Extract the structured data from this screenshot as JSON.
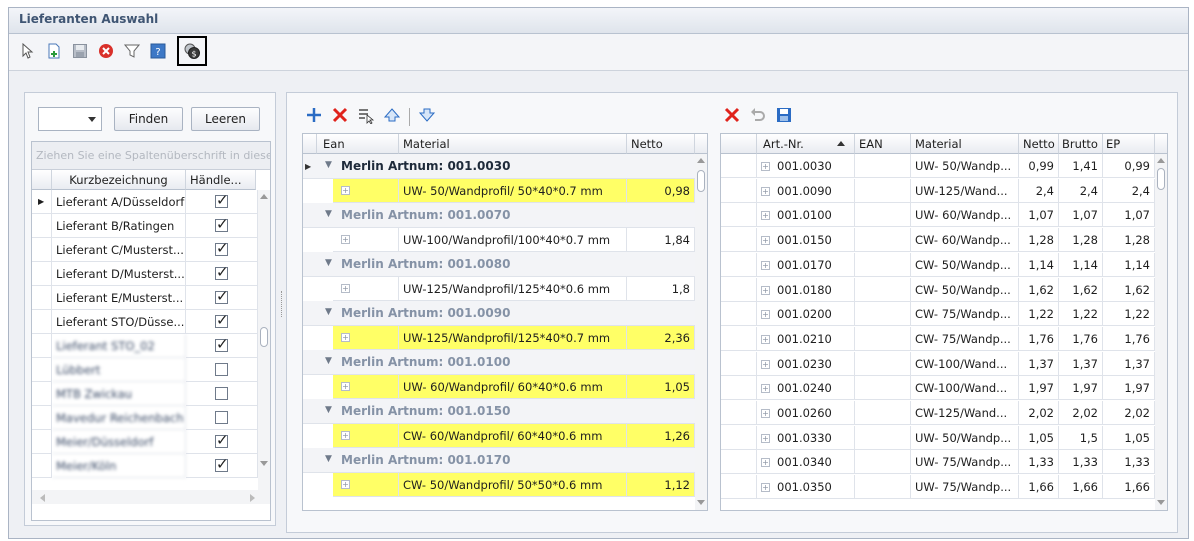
{
  "window": {
    "title": "Lieferanten Auswahl"
  },
  "toolbar": {
    "icons": [
      "cursor-icon",
      "new-document-icon",
      "save-icon",
      "delete-icon",
      "filter-icon",
      "help-icon",
      "coins-icon"
    ]
  },
  "search": {
    "finden_label": "Finden",
    "leeren_label": "Leeren",
    "combo_value": ""
  },
  "left_grid": {
    "group_hint": "Ziehen Sie eine Spaltenüberschrift in diesen Bereich, um nach dieser Spalte zu gruppieren",
    "columns": [
      "Kurzbezeichnung",
      "Händle..."
    ],
    "rows": [
      {
        "name": "Lieferant A/Düsseldorf",
        "checked": true,
        "blurred": false
      },
      {
        "name": "Lieferant B/Ratingen",
        "checked": true,
        "blurred": false
      },
      {
        "name": "Lieferant C/Musterst...",
        "checked": true,
        "blurred": false
      },
      {
        "name": "Lieferant D/Musterst...",
        "checked": true,
        "blurred": false
      },
      {
        "name": "Lieferant E/Musterst...",
        "checked": true,
        "blurred": false
      },
      {
        "name": "Lieferant STO/Düsse...",
        "checked": true,
        "blurred": false
      },
      {
        "name": "Lieferant STO_02",
        "checked": true,
        "blurred": true
      },
      {
        "name": "Lübbert",
        "checked": false,
        "blurred": true
      },
      {
        "name": "MTB Zwickau",
        "checked": false,
        "blurred": true
      },
      {
        "name": "Mavedur Reichenbach",
        "checked": false,
        "blurred": true
      },
      {
        "name": "Meier/Düsseldorf",
        "checked": true,
        "blurred": true
      },
      {
        "name": "Meier/Köln",
        "checked": true,
        "blurred": true
      }
    ]
  },
  "mid_toolbar": {
    "icons": [
      "add-icon",
      "delete-icon",
      "edit-select-icon",
      "move-up-icon",
      "move-down-icon"
    ]
  },
  "mid_grid": {
    "columns": [
      "Ean",
      "Material",
      "Netto"
    ],
    "groups": [
      {
        "label": "Merlin Artnum: 001.0030",
        "material": "UW- 50/Wandprofil/ 50*40*0.7 mm",
        "netto": "0,98",
        "highlight": true,
        "dim": false
      },
      {
        "label": "Merlin Artnum: 001.0070",
        "material": "UW-100/Wandprofil/100*40*0.7 mm",
        "netto": "1,84",
        "highlight": false,
        "dim": true
      },
      {
        "label": "Merlin Artnum: 001.0080",
        "material": "UW-125/Wandprofil/125*40*0.6 mm",
        "netto": "1,8",
        "highlight": false,
        "dim": true
      },
      {
        "label": "Merlin Artnum: 001.0090",
        "material": "UW-125/Wandprofil/125*40*0.7 mm",
        "netto": "2,36",
        "highlight": true,
        "dim": true
      },
      {
        "label": "Merlin Artnum: 001.0100",
        "material": "UW- 60/Wandprofil/ 60*40*0.6 mm",
        "netto": "1,05",
        "highlight": true,
        "dim": true
      },
      {
        "label": "Merlin Artnum: 001.0150",
        "material": "CW- 60/Wandprofil/ 60*40*0.6 mm",
        "netto": "1,26",
        "highlight": true,
        "dim": true
      },
      {
        "label": "Merlin Artnum: 001.0170",
        "material": "CW- 50/Wandprofil/ 50*50*0.6 mm",
        "netto": "1,12",
        "highlight": true,
        "dim": true
      }
    ]
  },
  "right_toolbar": {
    "icons": [
      "delete-icon",
      "undo-icon",
      "save-icon"
    ]
  },
  "right_grid": {
    "columns": [
      "Art.-Nr.",
      "EAN",
      "Material",
      "Netto",
      "Brutto",
      "EP"
    ],
    "rows": [
      [
        "001.0030",
        "",
        "UW- 50/Wandp...",
        "0,99",
        "1,41",
        "0,99"
      ],
      [
        "001.0090",
        "",
        "UW-125/Wand...",
        "2,4",
        "2,4",
        "2,4"
      ],
      [
        "001.0100",
        "",
        "UW- 60/Wandp...",
        "1,07",
        "1,07",
        "1,07"
      ],
      [
        "001.0150",
        "",
        "CW- 60/Wandp...",
        "1,28",
        "1,28",
        "1,28"
      ],
      [
        "001.0170",
        "",
        "CW- 50/Wandp...",
        "1,14",
        "1,14",
        "1,14"
      ],
      [
        "001.0180",
        "",
        "CW- 50/Wandp...",
        "1,62",
        "1,62",
        "1,62"
      ],
      [
        "001.0200",
        "",
        "CW- 75/Wandp...",
        "1,22",
        "1,22",
        "1,22"
      ],
      [
        "001.0210",
        "",
        "CW- 75/Wandp...",
        "1,76",
        "1,76",
        "1,76"
      ],
      [
        "001.0230",
        "",
        "CW-100/Wand...",
        "1,37",
        "1,37",
        "1,37"
      ],
      [
        "001.0240",
        "",
        "CW-100/Wand...",
        "1,97",
        "1,97",
        "1,97"
      ],
      [
        "001.0260",
        "",
        "CW-125/Wand...",
        "2,02",
        "2,02",
        "2,02"
      ],
      [
        "001.0330",
        "",
        "UW- 50/Wandp...",
        "1,05",
        "1,5",
        "1,05"
      ],
      [
        "001.0340",
        "",
        "UW- 75/Wandp...",
        "1,33",
        "1,33",
        "1,33"
      ],
      [
        "001.0350",
        "",
        "UW- 75/Wandp...",
        "1,66",
        "1,66",
        "1,66"
      ]
    ]
  },
  "colors": {
    "highlight": "#ffff66",
    "accent": "#3f5573",
    "delete": "#e0231c"
  }
}
